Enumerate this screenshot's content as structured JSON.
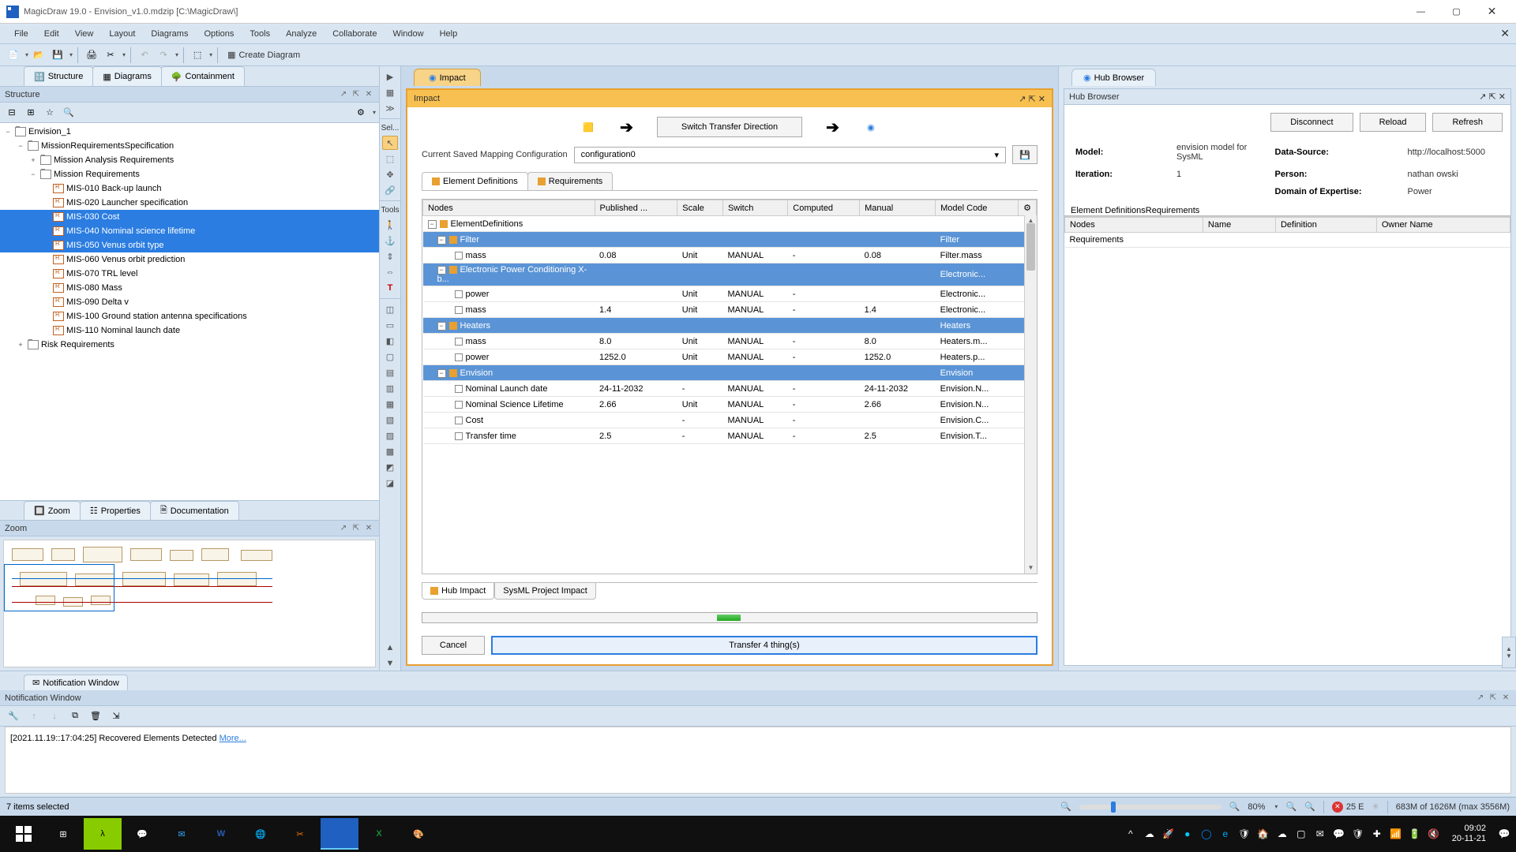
{
  "window": {
    "title": "MagicDraw 19.0 - Envision_v1.0.mdzip [C:\\MagicDraw\\]",
    "min": "—",
    "max": "▢",
    "close": "✕"
  },
  "menu": [
    "File",
    "Edit",
    "View",
    "Layout",
    "Diagrams",
    "Options",
    "Tools",
    "Analyze",
    "Collaborate",
    "Window",
    "Help"
  ],
  "toolbar": {
    "create_diagram": "Create Diagram"
  },
  "left_tabs": {
    "structure": "Structure",
    "diagrams": "Diagrams",
    "containment": "Containment"
  },
  "structure": {
    "title": "Structure",
    "root": "Envision_1",
    "nodes": [
      {
        "indent": 1,
        "toggle": "−",
        "icon": "folder",
        "label": "MissionRequirementsSpecification"
      },
      {
        "indent": 2,
        "toggle": "+",
        "icon": "folder",
        "label": "Mission Analysis Requirements"
      },
      {
        "indent": 2,
        "toggle": "−",
        "icon": "folder",
        "label": "Mission Requirements"
      },
      {
        "indent": 3,
        "toggle": "",
        "icon": "req",
        "label": "MIS-010 Back-up launch"
      },
      {
        "indent": 3,
        "toggle": "",
        "icon": "req",
        "label": "MIS-020 Launcher specification"
      },
      {
        "indent": 3,
        "toggle": "",
        "icon": "req",
        "label": "MIS-030 Cost",
        "sel": true
      },
      {
        "indent": 3,
        "toggle": "",
        "icon": "req",
        "label": "MIS-040 Nominal science lifetime",
        "sel": true
      },
      {
        "indent": 3,
        "toggle": "",
        "icon": "req",
        "label": "MIS-050 Venus orbit type",
        "sel": true
      },
      {
        "indent": 3,
        "toggle": "",
        "icon": "req",
        "label": "MIS-060 Venus orbit prediction"
      },
      {
        "indent": 3,
        "toggle": "",
        "icon": "req",
        "label": "MIS-070 TRL level"
      },
      {
        "indent": 3,
        "toggle": "",
        "icon": "req",
        "label": "MIS-080 Mass"
      },
      {
        "indent": 3,
        "toggle": "",
        "icon": "req",
        "label": "MIS-090 Delta v"
      },
      {
        "indent": 3,
        "toggle": "",
        "icon": "req",
        "label": "MIS-100 Ground station antenna specifications"
      },
      {
        "indent": 3,
        "toggle": "",
        "icon": "req",
        "label": "MIS-110 Nominal launch date"
      },
      {
        "indent": 1,
        "toggle": "+",
        "icon": "folder",
        "label": "Risk Requirements"
      }
    ]
  },
  "lower_tabs": {
    "zoom": "Zoom",
    "properties": "Properties",
    "documentation": "Documentation"
  },
  "zoom": {
    "title": "Zoom"
  },
  "palette": {
    "sel": "Sel...",
    "tools": "Tools"
  },
  "impact": {
    "tab": "Impact",
    "title": "Impact",
    "switch": "Switch Transfer Direction",
    "cfg_label": "Current Saved Mapping Configuration",
    "cfg_value": "configuration0",
    "tabs": {
      "elem": "Element Definitions",
      "req": "Requirements"
    },
    "columns": [
      "Nodes",
      "Published ...",
      "Scale",
      "Switch",
      "Computed",
      "Manual",
      "Model Code"
    ],
    "root": "ElementDefinitions",
    "rows": [
      {
        "grp": true,
        "name": "Filter",
        "model": "Filter"
      },
      {
        "name": "mass",
        "pub": "0.08",
        "scale": "Unit",
        "switch": "MANUAL",
        "comp": "-",
        "manual": "0.08",
        "model": "Filter.mass"
      },
      {
        "grp": true,
        "name": "Electronic Power Conditioning X-b...",
        "model": "Electronic..."
      },
      {
        "name": "power",
        "pub": "",
        "scale": "Unit",
        "switch": "MANUAL",
        "comp": "-",
        "manual": "",
        "model": "Electronic..."
      },
      {
        "name": "mass",
        "pub": "1.4",
        "scale": "Unit",
        "switch": "MANUAL",
        "comp": "-",
        "manual": "1.4",
        "model": "Electronic..."
      },
      {
        "grp": true,
        "name": "Heaters",
        "model": "Heaters"
      },
      {
        "name": "mass",
        "pub": "8.0",
        "scale": "Unit",
        "switch": "MANUAL",
        "comp": "-",
        "manual": "8.0",
        "model": "Heaters.m..."
      },
      {
        "name": "power",
        "pub": "1252.0",
        "scale": "Unit",
        "switch": "MANUAL",
        "comp": "-",
        "manual": "1252.0",
        "model": "Heaters.p..."
      },
      {
        "grp": true,
        "name": "Envision",
        "model": "Envision"
      },
      {
        "name": "Nominal Launch date",
        "pub": "24-11-2032",
        "scale": "-",
        "switch": "MANUAL",
        "comp": "-",
        "manual": "24-11-2032",
        "model": "Envision.N..."
      },
      {
        "name": "Nominal Science Lifetime",
        "pub": "2.66",
        "scale": "Unit",
        "switch": "MANUAL",
        "comp": "-",
        "manual": "2.66",
        "model": "Envision.N..."
      },
      {
        "name": "Cost",
        "pub": "",
        "scale": "-",
        "switch": "MANUAL",
        "comp": "-",
        "manual": "",
        "model": "Envision.C..."
      },
      {
        "name": "Transfer time",
        "pub": "2.5",
        "scale": "-",
        "switch": "MANUAL",
        "comp": "-",
        "manual": "2.5",
        "model": "Envision.T..."
      }
    ],
    "bottom_tabs": {
      "hub": "Hub Impact",
      "sysml": "SysML Project Impact"
    },
    "cancel": "Cancel",
    "transfer": "Transfer 4 thing(s)"
  },
  "hub": {
    "tab": "Hub Browser",
    "title": "Hub Browser",
    "disconnect": "Disconnect",
    "reload": "Reload",
    "refresh": "Refresh",
    "info": {
      "model_k": "Model:",
      "model_v": "envision model for SysML",
      "ds_k": "Data-Source:",
      "ds_v": "http://localhost:5000",
      "iter_k": "Iteration:",
      "iter_v": "1",
      "person_k": "Person:",
      "person_v": "nathan owski",
      "doe_k": "Domain of Expertise:",
      "doe_v": "Power"
    },
    "tabs": {
      "elem": "Element Definitions",
      "req": "Requirements"
    },
    "columns": [
      "Nodes",
      "Name",
      "Definition",
      "Owner Name"
    ],
    "row": "Requirements"
  },
  "notif": {
    "tab": "Notification Window",
    "title": "Notification Window",
    "line": "[2021.11.19::17:04:25]  Recovered Elements Detected ",
    "link": "More..."
  },
  "status": {
    "left": "7 items selected",
    "zoom": "80%",
    "err": "25 E",
    "mem": "683M of 1626M (max 3556M)"
  },
  "taskbar": {
    "time": "09:02",
    "date": "20-11-21"
  }
}
